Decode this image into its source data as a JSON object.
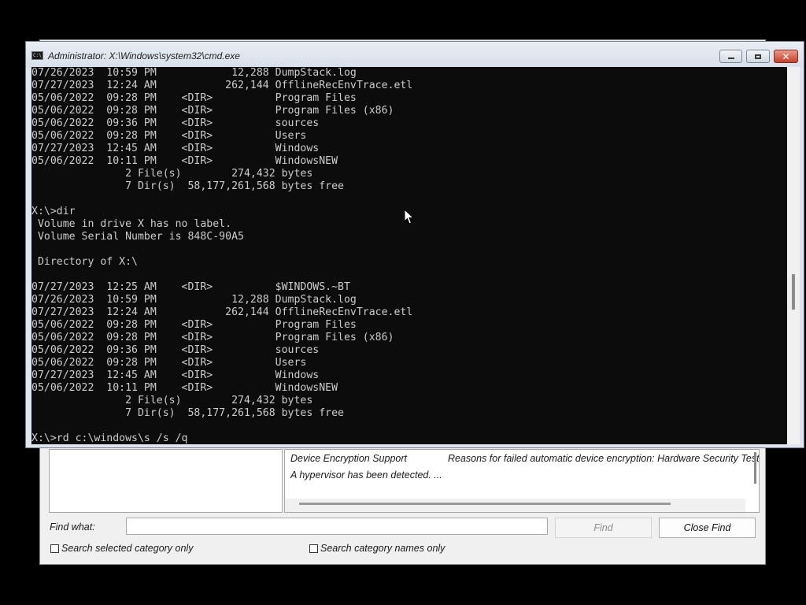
{
  "sysinfo": {
    "results": [
      {
        "item": "Device Encryption Support",
        "value": "Reasons for failed automatic device encryption: Hardware Security Test Interface failed and device is not Modern Standby"
      },
      {
        "item": "A hypervisor has been detected. ...",
        "value": ""
      }
    ],
    "find_what_label": "Find what:",
    "find_input_value": "",
    "find_button": "Find",
    "close_find_button": "Close Find",
    "search_selected_label": "Search selected category only",
    "search_names_label": "Search category names only"
  },
  "cmd": {
    "title": "Administrator: X:\\Windows\\system32\\cmd.exe",
    "icon_text": "C:\\",
    "lines": [
      "07/26/2023  10:59 PM            12,288 DumpStack.log",
      "07/27/2023  12:24 AM           262,144 OfflineRecEnvTrace.etl",
      "05/06/2022  09:28 PM    <DIR>          Program Files",
      "05/06/2022  09:28 PM    <DIR>          Program Files (x86)",
      "05/06/2022  09:36 PM    <DIR>          sources",
      "05/06/2022  09:28 PM    <DIR>          Users",
      "07/27/2023  12:45 AM    <DIR>          Windows",
      "05/06/2022  10:11 PM    <DIR>          WindowsNEW",
      "               2 File(s)        274,432 bytes",
      "               7 Dir(s)  58,177,261,568 bytes free",
      "",
      "X:\\>dir",
      " Volume in drive X has no label.",
      " Volume Serial Number is 848C-90A5",
      "",
      " Directory of X:\\",
      "",
      "07/27/2023  12:25 AM    <DIR>          $WINDOWS.~BT",
      "07/26/2023  10:59 PM            12,288 DumpStack.log",
      "07/27/2023  12:24 AM           262,144 OfflineRecEnvTrace.etl",
      "05/06/2022  09:28 PM    <DIR>          Program Files",
      "05/06/2022  09:28 PM    <DIR>          Program Files (x86)",
      "05/06/2022  09:36 PM    <DIR>          sources",
      "05/06/2022  09:28 PM    <DIR>          Users",
      "07/27/2023  12:45 AM    <DIR>          Windows",
      "05/06/2022  10:11 PM    <DIR>          WindowsNEW",
      "               2 File(s)        274,432 bytes",
      "               7 Dir(s)  58,177,261,568 bytes free",
      "",
      "X:\\>rd c:\\windows\\s /s /q"
    ]
  },
  "colors": {
    "console_bg": "#0c0c0c",
    "console_fg": "#cccccc",
    "close_button": "#c7402c"
  },
  "icons": [
    "cmd-icon",
    "minimize-icon",
    "maximize-icon",
    "close-icon",
    "mouse-cursor-icon"
  ]
}
